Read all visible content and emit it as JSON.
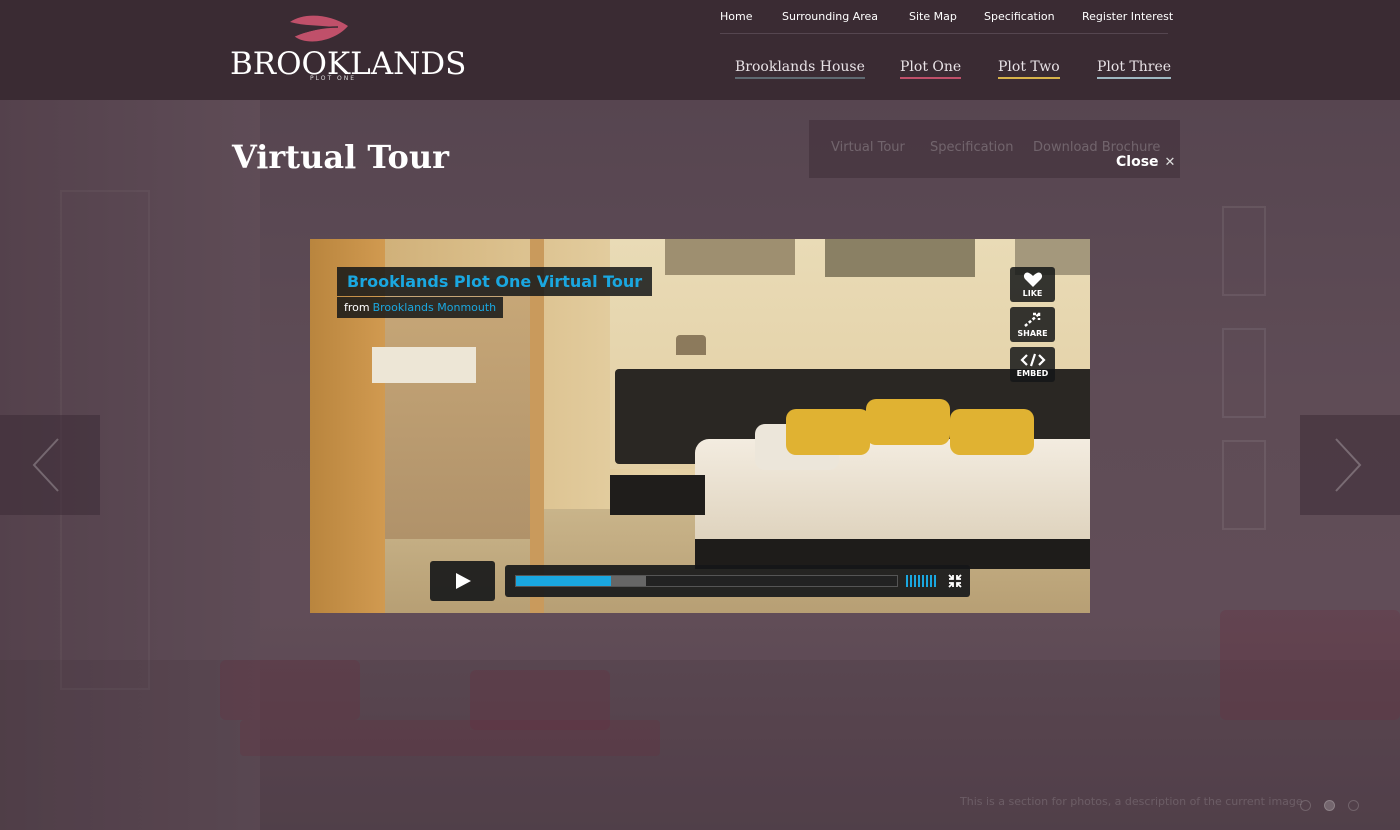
{
  "header": {
    "logo": {
      "wordmark": "BROOKLANDS",
      "subtitle": "PLOT ONE",
      "icon": "leaf-icon",
      "icon_color": "#c0506a"
    },
    "top_nav": [
      "Home",
      "Surrounding  Area",
      "Site Map",
      "Specification",
      "Register Interest"
    ],
    "main_nav": [
      {
        "label": "Brooklands House",
        "accent": "#5f6a72"
      },
      {
        "label": "Plot One",
        "accent": "#c0506a"
      },
      {
        "label": "Plot Two",
        "accent": "#d8b34a"
      },
      {
        "label": "Plot Three",
        "accent": "#9fb8c2"
      }
    ]
  },
  "page": {
    "title": "Virtual Tour",
    "subtabs": [
      "Virtual Tour",
      "Specification",
      "Download Brochure"
    ],
    "close_label": "Close",
    "close_icon": "close-icon"
  },
  "arrows": {
    "prev_icon": "chevron-left-icon",
    "next_icon": "chevron-right-icon"
  },
  "video": {
    "title": "Brooklands Plot One Virtual Tour",
    "from_label": "from",
    "from_name": "Brooklands Monmouth",
    "accent": "#1aa7e0",
    "side_buttons": [
      {
        "label": "LIKE",
        "icon": "heart-icon"
      },
      {
        "label": "SHARE",
        "icon": "share-icon"
      },
      {
        "label": "EMBED",
        "icon": "code-icon"
      }
    ],
    "controls": {
      "play_icon": "play-icon",
      "played_fraction": 0.25,
      "buffered_fraction": 0.34,
      "volume_icon": "volume-icon",
      "fullscreen_icon": "fullscreen-icon"
    }
  },
  "footer": {
    "caption": "This is a section for photos, a description of the current image",
    "slide_count": 3,
    "active_slide": 2
  }
}
